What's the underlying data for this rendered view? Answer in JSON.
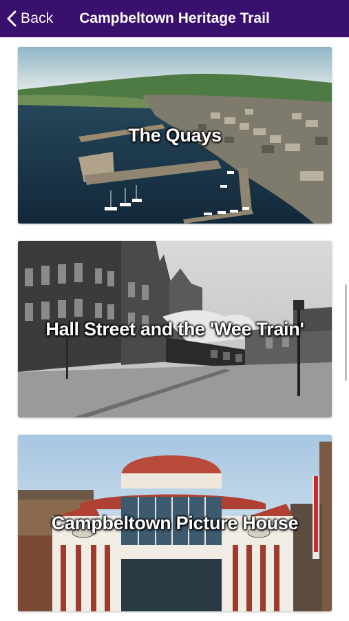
{
  "nav": {
    "back_label": "Back",
    "title": "Campbeltown Heritage Trail"
  },
  "cards": [
    {
      "title": "The Quays"
    },
    {
      "title": "Hall Street and the 'Wee Train'"
    },
    {
      "title": "Campbeltown Picture House"
    }
  ],
  "colors": {
    "navbar": "#3a106e",
    "title_text": "#ffffff"
  },
  "icons": {
    "back": "chevron-left-icon"
  }
}
